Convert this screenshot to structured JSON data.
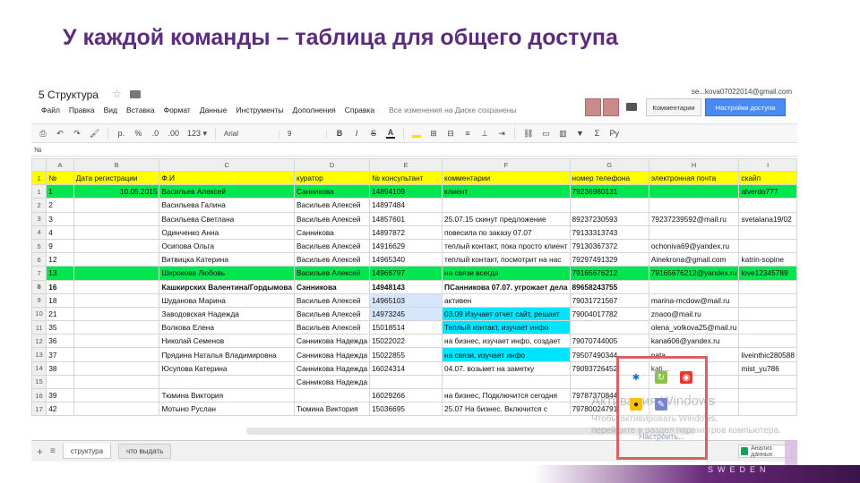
{
  "slide": {
    "title": "У каждой команды – таблица для общего доступа"
  },
  "doc": {
    "title": "5 Структура",
    "account": "se...kova07022014@gmail.com"
  },
  "menu": [
    "Файл",
    "Правка",
    "Вид",
    "Вставка",
    "Формат",
    "Данные",
    "Инструменты",
    "Дополнения",
    "Справка"
  ],
  "save_status": "Все изменения на Диске сохранены",
  "buttons": {
    "comments": "Комментарии",
    "share": "Настройки доступа"
  },
  "toolbar": {
    "print": "⎙",
    "undo": "↶",
    "redo": "↷",
    "paint": "🖌",
    "currency": "р.",
    "percent": "%",
    "dec_less": ".0",
    "dec_more": ".00",
    "format": "123 ▾",
    "font": "Arial",
    "size": "9",
    "bold": "B",
    "italic": "I",
    "strike": "S",
    "text_color": "A",
    "functions": "Σ",
    "language": "Ру"
  },
  "formula_bar": "№",
  "columns": [
    "",
    "A",
    "B",
    "C",
    "D",
    "E",
    "F",
    "G",
    "H",
    "I"
  ],
  "header_row": [
    "№",
    "Дата регистрации",
    "Ф.И",
    "куратор",
    "№ консультант",
    "комментарии",
    "номер телефона",
    "электронная почта",
    "скайп"
  ],
  "rows": [
    {
      "num": "1",
      "style": "green",
      "cells": [
        "1",
        "10.05.2015",
        "Васильев Алексей",
        "Санникова",
        "14894109",
        "клиент",
        "79236980131",
        "",
        "alverdo777"
      ]
    },
    {
      "num": "2",
      "style": "",
      "cells": [
        "2",
        "",
        "Васильева Галина",
        "Васильев Алексей",
        "14897484",
        "",
        "",
        "",
        ""
      ]
    },
    {
      "num": "3",
      "style": "",
      "cells": [
        "3",
        "",
        "Васильева Светлана",
        "Васильев Алексей",
        "14857601",
        "25.07.15 скинут предложение",
        "89237230593",
        "79237239592@mail.ru",
        "svetalana19/02"
      ]
    },
    {
      "num": "4",
      "style": "",
      "cells": [
        "4",
        "",
        "Одинченко Анна",
        "Санникова",
        "14897872",
        "повесила по заказу 07.07",
        "79133313743",
        "",
        ""
      ]
    },
    {
      "num": "5",
      "style": "",
      "cells": [
        "9",
        "",
        "Осипова Ольга",
        "Васильев Алексей",
        "14916629",
        "теплый контакт, пока просто клиент",
        "79130367372",
        "ochoniva69@yandex.ru",
        ""
      ]
    },
    {
      "num": "6",
      "style": "",
      "cells": [
        "12",
        "",
        "Витвицка Катерина",
        "Васильев Алексей",
        "14965340",
        "теплый контакт, посмотрит на нас",
        "79297491329",
        "Ainekrona@gmail.com",
        "katrin-sopine"
      ]
    },
    {
      "num": "7",
      "style": "green",
      "cells": [
        "13",
        "",
        "Широкова Любовь",
        "Васильев Алексей",
        "14968797",
        "на связи всегда",
        "79165676212",
        "79165676212@yandex.ru",
        "love12345789"
      ]
    },
    {
      "num": "8",
      "style": "bold",
      "cells": [
        "16",
        "",
        "Кашкирских Валентина/Гордымова",
        "Санникова",
        "14948143",
        "ПСанникова 07.07. угрожает дела",
        "89658243755",
        "",
        ""
      ]
    },
    {
      "num": "9",
      "style": "",
      "cells": [
        "18",
        "",
        "Шуданова Марина",
        "Васильев Алексей",
        "14965103",
        "активен",
        "79031721567",
        "marina-mcdow@mail.ru",
        ""
      ]
    },
    {
      "num": "10",
      "style": "",
      "cells": [
        "21",
        "",
        "Заводовская Надежда",
        "Васильев Алексей",
        "14973245",
        "03.09 Изучает отчет сайт, решает",
        "79004017782",
        "znaoo@mail.ru",
        ""
      ]
    },
    {
      "num": "11",
      "style": "",
      "cells": [
        "35",
        "",
        "Волкова Елена",
        "Васильев Алексей",
        "15018514",
        "Теплый контакт, изучает инфо",
        "",
        "olena_volkova25@mail.ru",
        ""
      ]
    },
    {
      "num": "12",
      "style": "",
      "cells": [
        "36",
        "",
        "Николай Семенов",
        "Санникова Надежда",
        "15022022",
        "на бизнес, изучает инфо, создает",
        "79070744005",
        "kana606@yandex.ru",
        ""
      ]
    },
    {
      "num": "13",
      "style": "",
      "cells": [
        "37",
        "",
        "Прядина Наталья Владимировна",
        "Санникова Надежда",
        "15022855",
        "на связи, изучает инфо",
        "79507490344",
        "nata...",
        "liveinthic280588"
      ]
    },
    {
      "num": "14",
      "style": "",
      "cells": [
        "38",
        "",
        "Юсупова Катерина",
        "Санникова Надежда",
        "16024314",
        "04.07. возьмет на заметку",
        "79093726452",
        "katj...",
        "mist_yu786"
      ]
    },
    {
      "num": "15",
      "style": "",
      "cells": [
        "",
        "",
        "",
        "Санникова Надежда",
        "",
        "",
        "",
        "",
        ""
      ]
    },
    {
      "num": "16",
      "style": "",
      "cells": [
        "39",
        "",
        "Тюмина Виктория",
        "",
        "16029266",
        "на бизнес, Подключится сегодня",
        "79787370844",
        "",
        ""
      ]
    },
    {
      "num": "17",
      "style": "",
      "cells": [
        "42",
        "",
        "Мотыно Руслан",
        "Тюмина Виктория",
        "15036695",
        "25.07 На бизнес. Включится с",
        "79780024791",
        "",
        ""
      ]
    }
  ],
  "sheet_tabs": {
    "active": "структура",
    "other": "что выдать"
  },
  "explore": "Анализ данных",
  "watermark": {
    "title": "Активация Windows",
    "line1": "Чтобы активировать Windows,",
    "line2": "перейдите в раздел параметров компьютера.",
    "link": "Настроить..."
  },
  "brand": {
    "letter": "E",
    "country": "SWEDEN"
  }
}
